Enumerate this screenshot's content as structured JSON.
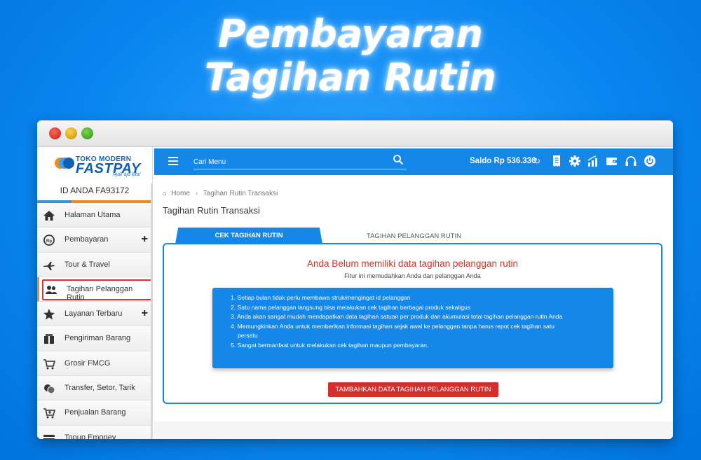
{
  "headline": {
    "line1": "Pembayaran",
    "line2": "Tagihan Rutin"
  },
  "brand": {
    "top": "TOKO MODERN",
    "main": "FASTPAY",
    "tagline": "Ajak aja kita!"
  },
  "sidebar": {
    "user_id": "ID ANDA FA93172",
    "items": [
      {
        "label": "Halaman Utama",
        "icon": "home-icon",
        "plus": ""
      },
      {
        "label": "Pembayaran",
        "icon": "payment-icon",
        "plus": "+"
      },
      {
        "label": "Tour & Travel",
        "icon": "airplane-icon",
        "plus": ""
      },
      {
        "label": "Tagihan Pelanggan Rutin",
        "icon": "customers-icon",
        "plus": ""
      },
      {
        "label": "Layanan Terbaru",
        "icon": "star-icon",
        "plus": "+"
      },
      {
        "label": "Pengiriman Barang",
        "icon": "package-icon",
        "plus": ""
      },
      {
        "label": "Grosir FMCG",
        "icon": "cart-icon",
        "plus": ""
      },
      {
        "label": "Transfer, Setor, Tarik",
        "icon": "coins-icon",
        "plus": ""
      },
      {
        "label": "Penjualan Barang",
        "icon": "cart-add-icon",
        "plus": ""
      },
      {
        "label": "Topup Emoney",
        "icon": "card-icon",
        "plus": ""
      }
    ]
  },
  "topbar": {
    "search_placeholder": "Cari Menu",
    "saldo": "Saldo Rp 536.336",
    "icons": [
      "receipt-icon",
      "gear-icon",
      "chart-icon",
      "wallet-icon",
      "headset-icon",
      "power-icon"
    ]
  },
  "breadcrumb": {
    "home": "Home",
    "current": "Tagihan Rutin Transaksi"
  },
  "page_title": "Tagihan Rutin Transaksi",
  "tabs": {
    "active": "CEK TAGIHAN RUTIN",
    "inactive": "TAGIHAN PELANGGAN RUTIN"
  },
  "panel": {
    "title": "Anda Belum memiliki data tagihan pelanggan rutin",
    "subtitle": "Fitur ini memudahkan Anda dan pelanggan Anda",
    "benefits": [
      "1. Setiap bulan tidak perlu membawa struk/mengingat id pelanggan",
      "2. Satu nama pelanggan langsung bisa melakukan cek tagihan berbagai produk sekaligus",
      "3. Anda akan sangat mudah mendapatkan data tagihan satuan per produk dan akumulasi total tagihan pelanggan rutin Anda",
      "4. Memungkinkan Anda untuk memberikan informasi tagihan sejak awal ke pelanggan tanpa harus repot cek tagihan satu",
      "persatu",
      "5. Sangat bermanfaat untuk melakukan cek tagihan maupun pembayaran."
    ],
    "button": "TAMBAHKAN DATA TAGIHAN PELANGGAN RUTIN"
  },
  "colors": {
    "primary": "#1487e8",
    "accent": "#f28a1e",
    "danger": "#d32f2f",
    "title_red": "#c0392b"
  }
}
